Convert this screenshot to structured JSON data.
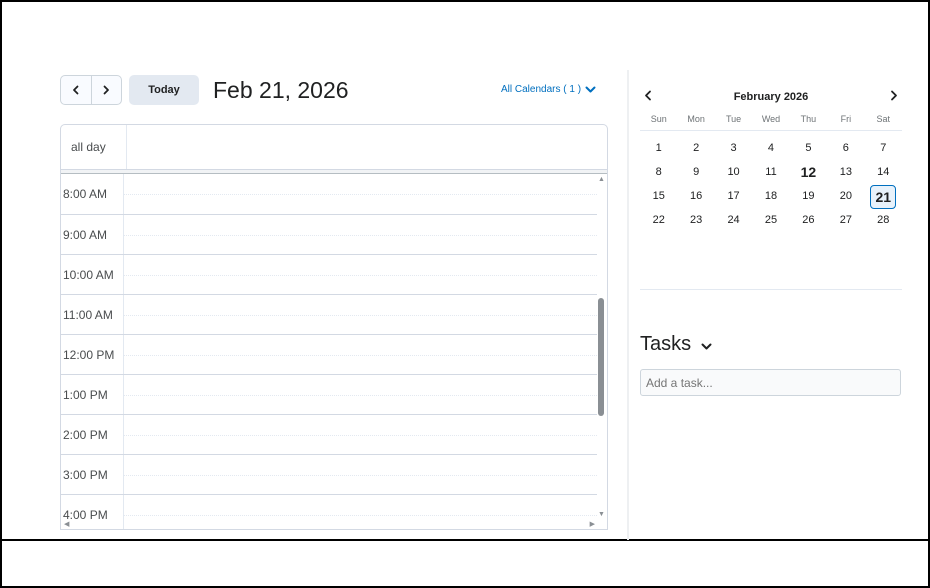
{
  "toolbar": {
    "prev_icon": "chevron-left-icon",
    "next_icon": "chevron-right-icon",
    "today_label": "Today",
    "date_title": "Feb 21, 2026",
    "all_calendars_label": "All Calendars ( 1 )",
    "accent_color": "#006fbf"
  },
  "day_view": {
    "all_day_label": "all day",
    "time_slots": [
      "8:00 AM",
      "9:00 AM",
      "10:00 AM",
      "11:00 AM",
      "12:00 PM",
      "1:00 PM",
      "2:00 PM",
      "3:00 PM",
      "4:00 PM"
    ]
  },
  "mini_calendar": {
    "month_title": "February 2026",
    "weekdays": [
      "Sun",
      "Mon",
      "Tue",
      "Wed",
      "Thu",
      "Fri",
      "Sat"
    ],
    "days": [
      "1",
      "2",
      "3",
      "4",
      "5",
      "6",
      "7",
      "8",
      "9",
      "10",
      "11",
      "12",
      "13",
      "14",
      "15",
      "16",
      "17",
      "18",
      "19",
      "20",
      "21",
      "22",
      "23",
      "24",
      "25",
      "26",
      "27",
      "28"
    ],
    "today": "12",
    "selected": "21"
  },
  "tasks": {
    "title": "Tasks",
    "add_placeholder": "Add a task..."
  }
}
